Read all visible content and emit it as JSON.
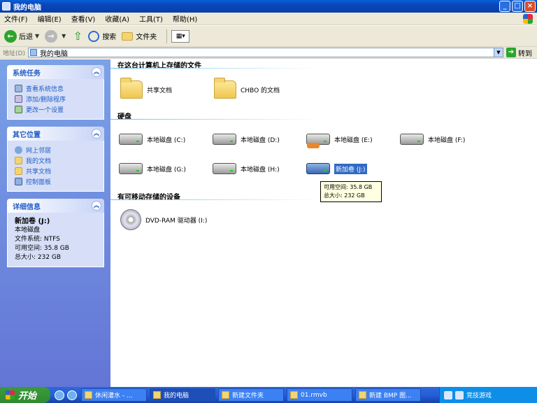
{
  "window": {
    "title": "我的电脑",
    "buttons": [
      "_",
      "□",
      "×"
    ]
  },
  "menu": [
    "文件(F)",
    "编辑(E)",
    "查看(V)",
    "收藏(A)",
    "工具(T)",
    "帮助(H)"
  ],
  "toolbar": {
    "back": "后退",
    "search": "搜索",
    "folders": "文件夹"
  },
  "address": {
    "label": "地址(D)",
    "value": "我的电脑",
    "go": "转到"
  },
  "sidebar": {
    "system_tasks": {
      "title": "系统任务",
      "items": [
        "查看系统信息",
        "添加/删除程序",
        "更改一个设置"
      ]
    },
    "other_places": {
      "title": "其它位置",
      "items": [
        "网上邻居",
        "我的文档",
        "共享文档",
        "控制面板"
      ]
    },
    "details": {
      "title": "详细信息",
      "name": "新加卷 (J:)",
      "type": "本地磁盘",
      "fs": "文件系统: NTFS",
      "free": "可用空间: 35.8 GB",
      "total": "总大小: 232 GB"
    }
  },
  "main": {
    "files_group": "在这台计算机上存储的文件",
    "folders": [
      "共享文档",
      "CHBO 的文档"
    ],
    "drives_group": "硬盘",
    "drives": [
      "本地磁盘 (C:)",
      "本地磁盘 (D:)",
      "本地磁盘 (E:)",
      "本地磁盘 (F:)",
      "本地磁盘 (G:)",
      "本地磁盘 (H:)",
      "新加卷 (J:)"
    ],
    "removable_group": "有可移动存储的设备",
    "removable": [
      "DVD-RAM 驱动器 (I:)"
    ],
    "tooltip": {
      "free": "可用空间: 35.8 GB",
      "total": "总大小: 232 GB"
    }
  },
  "taskbar": {
    "start": "开始",
    "tasks": [
      "休闲灌水 - ...",
      "我的电脑",
      "新建文件夹",
      "01.rmvb",
      "新建 BMP 图..."
    ],
    "watermark": "竞技游戏"
  }
}
